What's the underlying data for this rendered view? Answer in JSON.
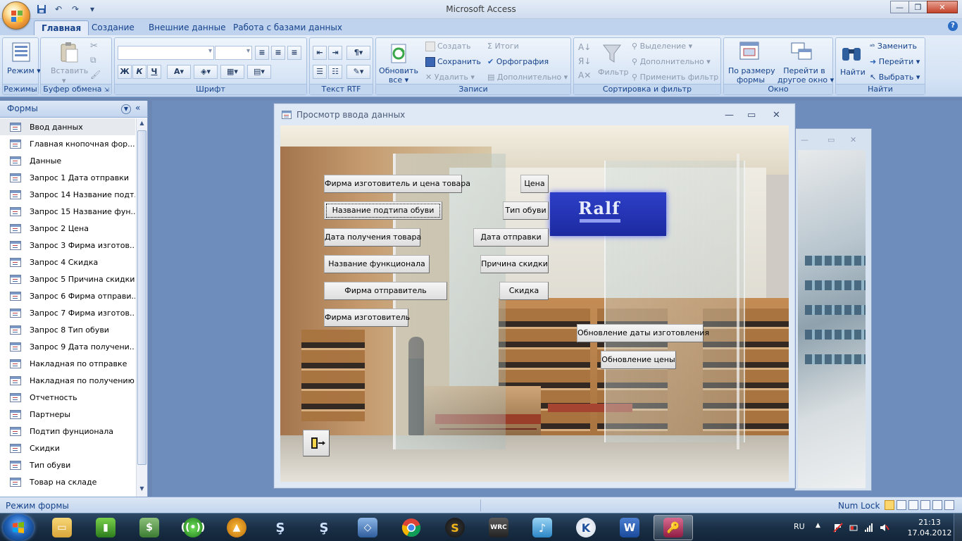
{
  "app": {
    "title": "Microsoft Access",
    "quick_access": [
      "save-icon",
      "undo-icon",
      "redo-icon",
      "customize-icon"
    ]
  },
  "ribbon_tabs": [
    {
      "label": "Главная",
      "active": true
    },
    {
      "label": "Создание",
      "active": false
    },
    {
      "label": "Внешние данные",
      "active": false
    },
    {
      "label": "Работа с базами данных",
      "active": false
    }
  ],
  "ribbon": {
    "views": {
      "mode_label": "Режим",
      "group": "Режимы"
    },
    "clipboard": {
      "paste_label": "Вставить",
      "group": "Буфер обмена"
    },
    "font": {
      "group": "Шрифт",
      "bold": "Ж",
      "italic": "К",
      "underline": "Ч",
      "font_color": "A"
    },
    "rtf": {
      "group": "Текст RTF"
    },
    "records": {
      "refresh_label": "Обновить",
      "refresh_label2": "все",
      "create": "Создать",
      "save": "Сохранить",
      "delete": "Удалить",
      "totals": "Итоги",
      "spelling": "Орфография",
      "more": "Дополнительно",
      "group": "Записи"
    },
    "sort": {
      "filter": "Фильтр",
      "selection": "Выделение",
      "advanced": "Дополнительно",
      "apply_filter": "Применить фильтр",
      "group": "Сортировка и фильтр"
    },
    "window": {
      "fit_label": "По размеру",
      "fit_label2": "формы",
      "switch_label": "Перейти в",
      "switch_label2": "другое окно",
      "group": "Окно"
    },
    "find": {
      "find_label": "Найти",
      "replace": "Заменить",
      "goto": "Перейти",
      "select": "Выбрать",
      "group": "Найти"
    }
  },
  "nav": {
    "title": "Формы",
    "items": [
      {
        "label": "Ввод данных",
        "selected": true
      },
      {
        "label": "Главная кнопочная фор..."
      },
      {
        "label": "Данные"
      },
      {
        "label": "Запрос 1 Дата отправки"
      },
      {
        "label": "Запрос 14 Название подт..."
      },
      {
        "label": "Запрос 15 Название фун..."
      },
      {
        "label": "Запрос 2 Цена"
      },
      {
        "label": "Запрос 3 Фирма изготов..."
      },
      {
        "label": "Запрос 4 Скидка"
      },
      {
        "label": "Запрос 5 Причина скидки"
      },
      {
        "label": "Запрос 6 Фирма отправи..."
      },
      {
        "label": "Запрос 7 Фирма изготов..."
      },
      {
        "label": "Запрос 8 Тип обуви"
      },
      {
        "label": "Запрос 9 Дата получени..."
      },
      {
        "label": "Накладная по отправке"
      },
      {
        "label": "Накладная по получению"
      },
      {
        "label": "Отчетность"
      },
      {
        "label": "Партнеры"
      },
      {
        "label": "Подтип фунционала"
      },
      {
        "label": "Скидки"
      },
      {
        "label": "Тип обуви"
      },
      {
        "label": "Товар на складе"
      }
    ]
  },
  "form_window": {
    "title": "Просмотр ввода данных",
    "sign_text": "Ralf",
    "buttons": [
      {
        "label": "Фирма изготовитель и цена товара"
      },
      {
        "label": "Название подтипа обуви",
        "focused": true
      },
      {
        "label": "Дата получения товара"
      },
      {
        "label": "Название функционала"
      },
      {
        "label": "Фирма отправитель"
      },
      {
        "label": "Фирма изготовитель"
      },
      {
        "label": "Цена"
      },
      {
        "label": "Тип обуви"
      },
      {
        "label": "Дата отправки"
      },
      {
        "label": "Причина скидки"
      },
      {
        "label": "Скидка"
      },
      {
        "label": "Обновление даты изготовления"
      },
      {
        "label": "Обновление цены"
      }
    ]
  },
  "status": {
    "mode": "Режим формы",
    "numlock": "Num Lock"
  },
  "taskbar": {
    "apps": [
      "explorer",
      "battery-meter",
      "money",
      "network",
      "media-player",
      "starcraft",
      "starcraft-2",
      "virtualbox",
      "chrome",
      "app-s",
      "wrc",
      "music-editor",
      "kaspersky",
      "word",
      "access"
    ],
    "active_app": "access",
    "language": "RU",
    "time": "21:13",
    "date": "17.04.2012"
  },
  "colors": {
    "ribbon_text": "#15428b",
    "workspace": "#6e8cbc",
    "sign_blue": "#2d3fc8"
  }
}
